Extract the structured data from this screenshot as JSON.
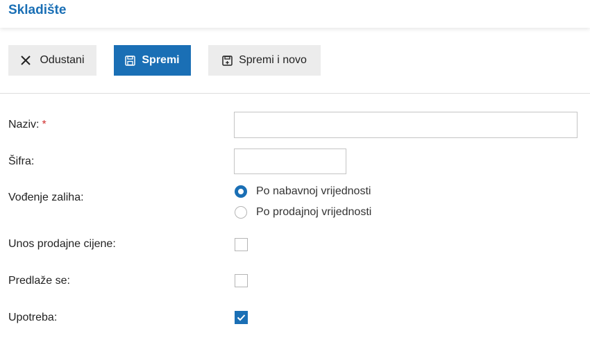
{
  "header": {
    "title": "Skladište"
  },
  "toolbar": {
    "cancel_label": "Odustani",
    "save_label": "Spremi",
    "save_new_label": "Spremi i novo"
  },
  "form": {
    "naziv": {
      "label": "Naziv:",
      "required_mark": "*",
      "value": ""
    },
    "sifra": {
      "label": "Šifra:",
      "value": ""
    },
    "vodenje_zaliha": {
      "label": "Vođenje zaliha:",
      "options": [
        "Po nabavnoj vrijednosti",
        "Po prodajnoj vrijednosti"
      ],
      "selected": "Po nabavnoj vrijednosti"
    },
    "unos_prodajne_cijene": {
      "label": "Unos prodajne cijene:",
      "checked": false
    },
    "predlaze_se": {
      "label": "Predlaže se:",
      "checked": false
    },
    "upotreba": {
      "label": "Upotreba:",
      "checked": true
    }
  },
  "colors": {
    "accent": "#1a6fb5",
    "required": "#d0302f",
    "button_secondary": "#ececec"
  },
  "icons": {
    "cancel": "close-icon",
    "save": "floppy-disk-icon",
    "save_new": "floppy-disk-plus-icon",
    "checkmark": "check-icon"
  }
}
